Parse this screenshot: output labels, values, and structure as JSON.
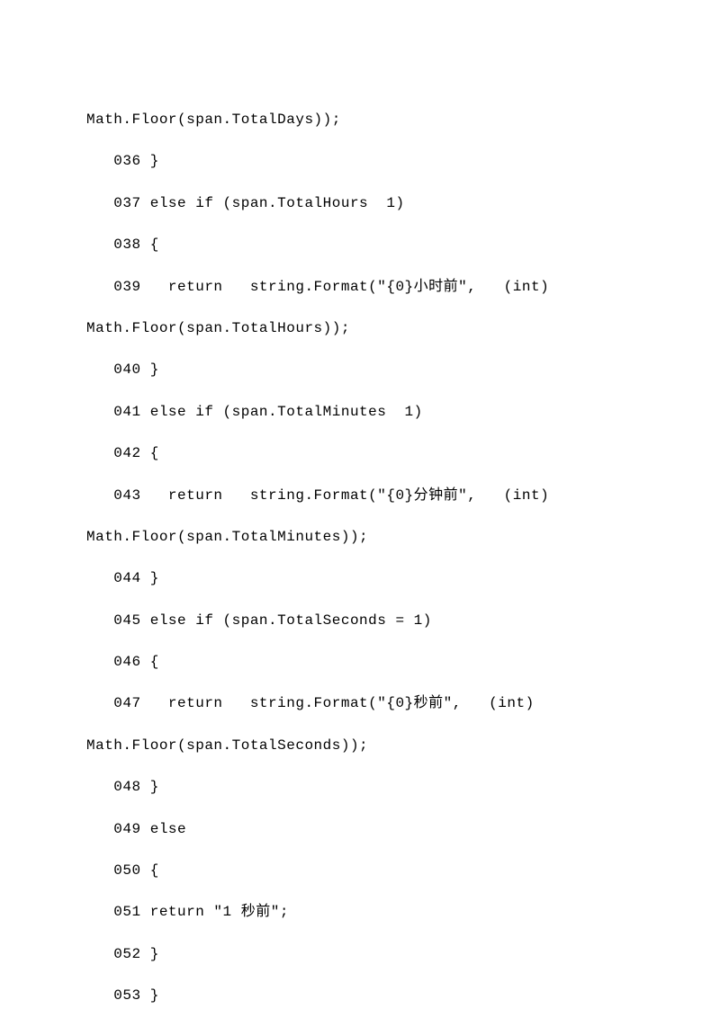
{
  "lines": [
    "Math.Floor(span.TotalDays));",
    "   036 }",
    "   037 else if (span.TotalHours  1)",
    "   038 {",
    "   039   return   string.Format(\"{0}小时前\",   (int)",
    "Math.Floor(span.TotalHours));",
    "   040 }",
    "   041 else if (span.TotalMinutes  1)",
    "   042 {",
    "   043   return   string.Format(\"{0}分钟前\",   (int)",
    "Math.Floor(span.TotalMinutes));",
    "   044 }",
    "   045 else if (span.TotalSeconds = 1)",
    "   046 {",
    "   047   return   string.Format(\"{0}秒前\",   (int)",
    "Math.Floor(span.TotalSeconds));",
    "   048 }",
    "   049 else",
    "   050 {",
    "   051 return \"1 秒前\";",
    "   052 }",
    "   053 }"
  ]
}
